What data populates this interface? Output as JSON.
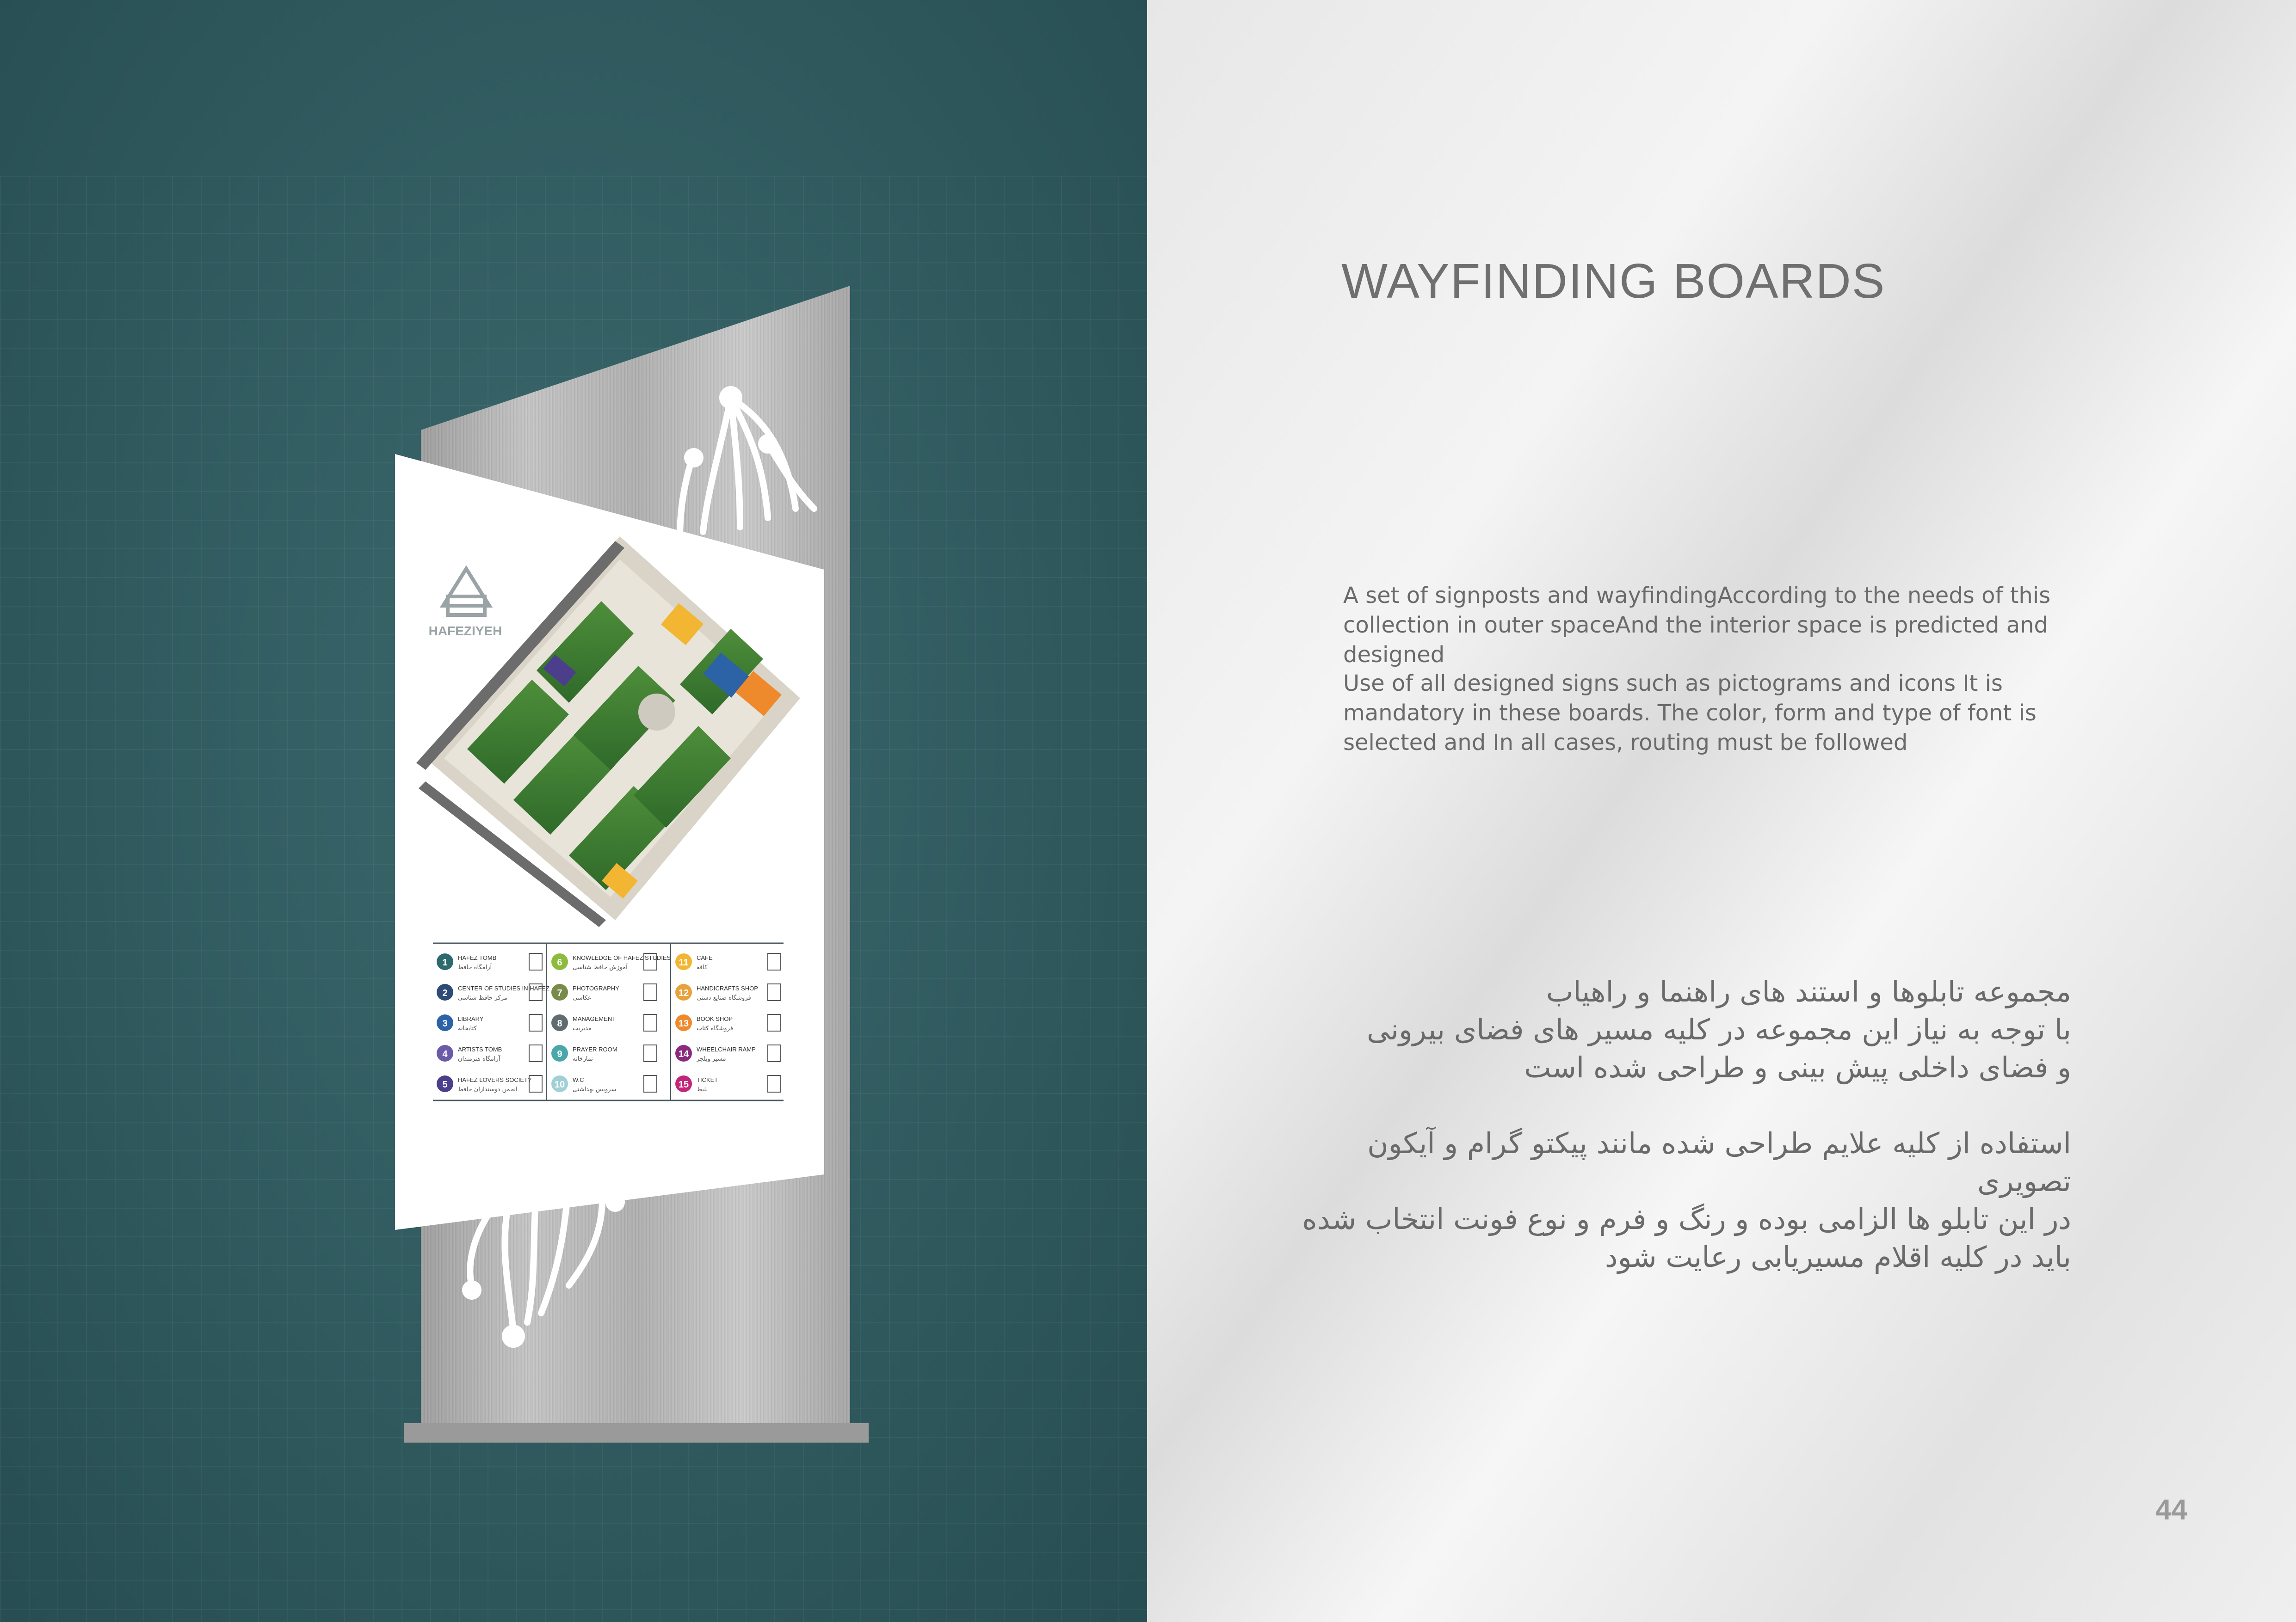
{
  "page": {
    "title": "WAYFINDING BOARDS",
    "number": "44"
  },
  "english": {
    "para1": "A set of signposts and wayfindingAccording to the needs of this collection in outer spaceAnd the interior space is predicted and designed",
    "para2": "Use of all designed signs such as pictograms and icons It is mandatory in these boards. The color, form and type of font is selected and    In all cases, routing must be followed"
  },
  "persian": {
    "para1": [
      "مجموعه تابلوها و استند های راهنما و راهیاب",
      "با توجه به نیاز این مجموعه در کلیه مسیر های فضای بیرونی",
      "و فضای داخلی پیش بینی و طراحی شده است"
    ],
    "para2": [
      "استفاده از کلیه علایم طراحی شده مانند پیکتو گرام و آیکون  تصویری",
      "در این تابلو ها الزامی بوده و رنگ و فرم و نوع فونت انتخاب شده",
      "باید در کلیه اقلام مسیریابی رعایت شود"
    ]
  },
  "sign": {
    "logo": "HAFEZIYEH",
    "legend": [
      {
        "num": "1",
        "label": "HAFEZ TOMB",
        "fa": "آرامگاه حافظ",
        "color": "#2c6a6e",
        "icon": "tomb-icon"
      },
      {
        "num": "2",
        "label": "CENTER OF STUDIES IN HAFEZ",
        "fa": "مرکز حافظ شناسی",
        "color": "#2e4b77",
        "icon": "center-icon"
      },
      {
        "num": "3",
        "label": "LIBRARY",
        "fa": "کتابخانه",
        "color": "#2b63a6",
        "icon": "library-icon"
      },
      {
        "num": "4",
        "label": "ARTISTS TOMB",
        "fa": "آرامگاه هنرمندان",
        "color": "#6a5aa8",
        "icon": "artists-tomb-icon"
      },
      {
        "num": "5",
        "label": "HAFEZ LOVERS SOCIETY",
        "fa": "انجمن دوستداران حافظ",
        "color": "#4b3f8c",
        "icon": "society-icon"
      },
      {
        "num": "6",
        "label": "KNOWLEDGE OF HAFEZ STUDIES",
        "fa": "آموزش حافظ شناسی",
        "color": "#8dbb3e",
        "icon": "book-icon"
      },
      {
        "num": "7",
        "label": "PHOTOGRAPHY",
        "fa": "عکاسی",
        "color": "#7a8a4a",
        "icon": "camera-icon"
      },
      {
        "num": "8",
        "label": "MANAGEMENT",
        "fa": "مدیریت",
        "color": "#5f6c72",
        "icon": "management-icon"
      },
      {
        "num": "9",
        "label": "PRAYER ROOM",
        "fa": "نمازخانه",
        "color": "#4aa7a9",
        "icon": "prayer-icon"
      },
      {
        "num": "10",
        "label": "W.C",
        "fa": "سرویس بهداشتی",
        "color": "#9fd0d6",
        "icon": "wc-icon"
      },
      {
        "num": "11",
        "label": "CAFE",
        "fa": "کافه",
        "color": "#f2b632",
        "icon": "cafe-icon"
      },
      {
        "num": "12",
        "label": "HANDICRAFTS SHOP",
        "fa": "فروشگاه صنایع دستی",
        "color": "#e9a23b",
        "icon": "shop-icon"
      },
      {
        "num": "13",
        "label": "BOOK SHOP",
        "fa": "فروشگاه کتاب",
        "color": "#ef8a2c",
        "icon": "bookshop-icon"
      },
      {
        "num": "14",
        "label": "WHEELCHAIR RAMP",
        "fa": "مسیر ویلچر",
        "color": "#8a2a7e",
        "icon": "wheelchair-icon"
      },
      {
        "num": "15",
        "label": "TICKET",
        "fa": "بلیط",
        "color": "#c2267a",
        "icon": "ticket-icon"
      }
    ]
  }
}
